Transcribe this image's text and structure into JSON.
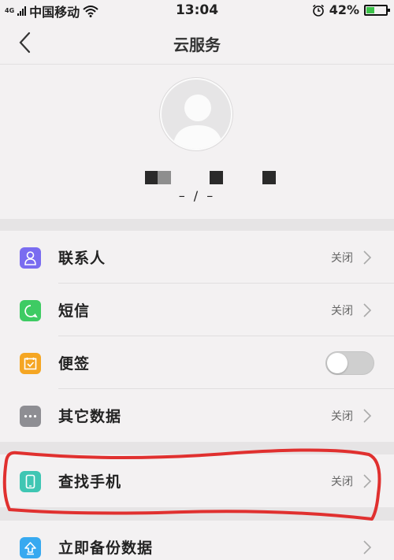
{
  "status_bar": {
    "network": "4G",
    "carrier": "中国移动",
    "time": "13:04",
    "battery": "42%",
    "battery_level": 0.42
  },
  "header": {
    "title": "云服务",
    "back_icon": "chevron-left-icon"
  },
  "profile": {
    "avatar_icon": "user-silhouette-icon",
    "subtext": "– / –"
  },
  "list_items": [
    {
      "label": "联系人",
      "status": "关闭",
      "icon": "contacts-icon",
      "color": "#7a6cf0"
    },
    {
      "label": "短信",
      "status": "关闭",
      "icon": "message-icon",
      "color": "#3ecb63"
    },
    {
      "label": "便签",
      "icon": "note-icon",
      "color": "#f5a623",
      "toggle_on": false
    },
    {
      "label": "其它数据",
      "status": "关闭",
      "icon": "more-icon",
      "color": "#8e8e93"
    },
    {
      "label": "查找手机",
      "status": "关闭",
      "icon": "phone-icon",
      "color": "#3fc6b3"
    },
    {
      "label": "立即备份数据",
      "icon": "upload-icon",
      "color": "#37a9f0"
    }
  ],
  "colors": {
    "background": "#f3f1f2",
    "separator": "#e6e4e5",
    "annotation": "#e0302f"
  }
}
